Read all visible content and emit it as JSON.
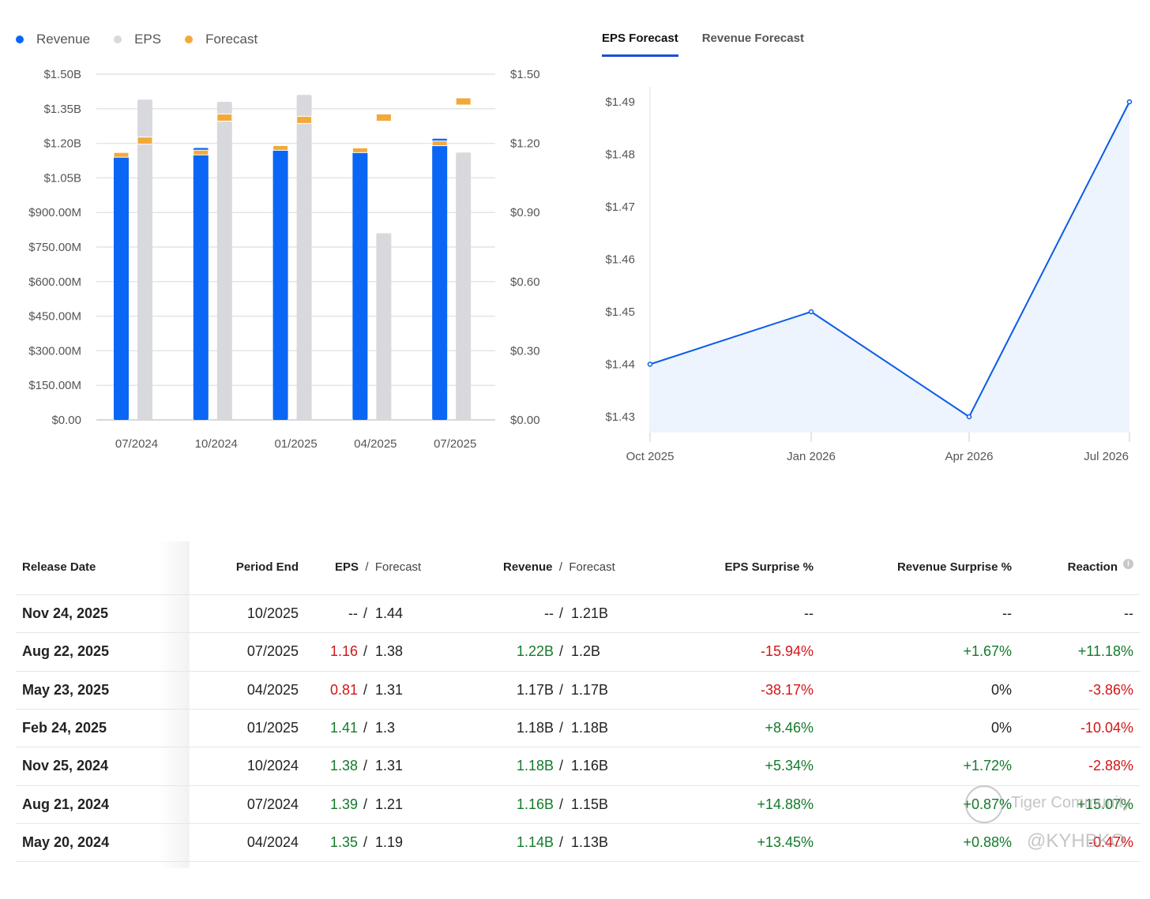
{
  "legend": {
    "revenue": "Revenue",
    "eps": "EPS",
    "forecast": "Forecast"
  },
  "colors": {
    "revenue": "#0a66f5",
    "eps": "#d8d9dc",
    "forecast": "#f2a93b",
    "line": "#0a5ce8",
    "area": "#eef4fd",
    "positive": "#137a2a",
    "negative": "#d31515"
  },
  "tabs": [
    {
      "label": "EPS Forecast",
      "active": true
    },
    {
      "label": "Revenue Forecast",
      "active": false
    }
  ],
  "chart_data": [
    {
      "type": "bar",
      "title": "Revenue and EPS",
      "categories": [
        "07/2024",
        "10/2024",
        "01/2025",
        "04/2025",
        "07/2025"
      ],
      "left_axis": {
        "ticks": [
          "$0.00",
          "$150.00M",
          "$300.00M",
          "$450.00M",
          "$600.00M",
          "$750.00M",
          "$900.00M",
          "$1.05B",
          "$1.20B",
          "$1.35B",
          "$1.50B"
        ],
        "ylim": [
          0,
          1.5
        ],
        "unit": "B"
      },
      "right_axis": {
        "ticks": [
          "$0.00",
          "$0.30",
          "$0.60",
          "$0.90",
          "$1.20",
          "$1.50"
        ],
        "ylim": [
          0,
          1.5
        ]
      },
      "series": [
        {
          "name": "Revenue",
          "values": [
            1.16,
            1.18,
            1.18,
            1.17,
            1.22
          ],
          "forecast": [
            1.15,
            1.16,
            1.18,
            1.17,
            1.2
          ]
        },
        {
          "name": "EPS",
          "values": [
            1.39,
            1.38,
            1.41,
            0.81,
            1.16
          ],
          "forecast": [
            1.21,
            1.31,
            1.3,
            1.31,
            1.38
          ]
        }
      ]
    },
    {
      "type": "area",
      "title": "EPS Forecast",
      "x": [
        "Oct 2025",
        "Jan 2026",
        "Apr 2026",
        "Jul 2026"
      ],
      "y": [
        1.44,
        1.45,
        1.43,
        1.49
      ],
      "ticks": [
        "$1.43",
        "$1.44",
        "$1.45",
        "$1.46",
        "$1.47",
        "$1.48",
        "$1.49"
      ],
      "ylim": [
        1.43,
        1.49
      ]
    }
  ],
  "table": {
    "headers": {
      "release": "Release Date",
      "period": "Period End",
      "eps": "EPS",
      "eps_fc": "Forecast",
      "rev": "Revenue",
      "rev_fc": "Forecast",
      "eps_surprise": "EPS Surprise %",
      "rev_surprise": "Revenue Surprise %",
      "reaction": "Reaction",
      "sep": "/"
    },
    "rows": [
      {
        "date": "Nov 24, 2025",
        "period": "10/2025",
        "eps": "--",
        "eps_fc": "1.44",
        "rev": "--",
        "rev_fc": "1.21B",
        "eps_s": "--",
        "rev_s": "--",
        "react": "--",
        "eps_c": "",
        "rev_c": "",
        "es_c": "",
        "rs_c": "",
        "re_c": ""
      },
      {
        "date": "Aug 22, 2025",
        "period": "07/2025",
        "eps": "1.16",
        "eps_fc": "1.38",
        "rev": "1.22B",
        "rev_fc": "1.2B",
        "eps_s": "-15.94%",
        "rev_s": "+1.67%",
        "react": "+11.18%",
        "eps_c": "neg",
        "rev_c": "pos",
        "es_c": "neg",
        "rs_c": "pos",
        "re_c": "pos"
      },
      {
        "date": "May 23, 2025",
        "period": "04/2025",
        "eps": "0.81",
        "eps_fc": "1.31",
        "rev": "1.17B",
        "rev_fc": "1.17B",
        "eps_s": "-38.17%",
        "rev_s": "0%",
        "react": "-3.86%",
        "eps_c": "neg",
        "rev_c": "",
        "es_c": "neg",
        "rs_c": "",
        "re_c": "neg"
      },
      {
        "date": "Feb 24, 2025",
        "period": "01/2025",
        "eps": "1.41",
        "eps_fc": "1.3",
        "rev": "1.18B",
        "rev_fc": "1.18B",
        "eps_s": "+8.46%",
        "rev_s": "0%",
        "react": "-10.04%",
        "eps_c": "pos",
        "rev_c": "",
        "es_c": "pos",
        "rs_c": "",
        "re_c": "neg"
      },
      {
        "date": "Nov 25, 2024",
        "period": "10/2024",
        "eps": "1.38",
        "eps_fc": "1.31",
        "rev": "1.18B",
        "rev_fc": "1.16B",
        "eps_s": "+5.34%",
        "rev_s": "+1.72%",
        "react": "-2.88%",
        "eps_c": "pos",
        "rev_c": "pos",
        "es_c": "pos",
        "rs_c": "pos",
        "re_c": "neg"
      },
      {
        "date": "Aug 21, 2024",
        "period": "07/2024",
        "eps": "1.39",
        "eps_fc": "1.21",
        "rev": "1.16B",
        "rev_fc": "1.15B",
        "eps_s": "+14.88%",
        "rev_s": "+0.87%",
        "react": "+15.07%",
        "eps_c": "pos",
        "rev_c": "pos",
        "es_c": "pos",
        "rs_c": "pos",
        "re_c": "pos"
      },
      {
        "date": "May 20, 2024",
        "period": "04/2024",
        "eps": "1.35",
        "eps_fc": "1.19",
        "rev": "1.14B",
        "rev_fc": "1.13B",
        "eps_s": "+13.45%",
        "rev_s": "+0.88%",
        "react": "-0.47%",
        "eps_c": "pos",
        "rev_c": "pos",
        "es_c": "pos",
        "rs_c": "pos",
        "re_c": "neg"
      }
    ]
  },
  "watermark": {
    "line1": "Tiger Community",
    "line2": "@KYHBKO"
  }
}
